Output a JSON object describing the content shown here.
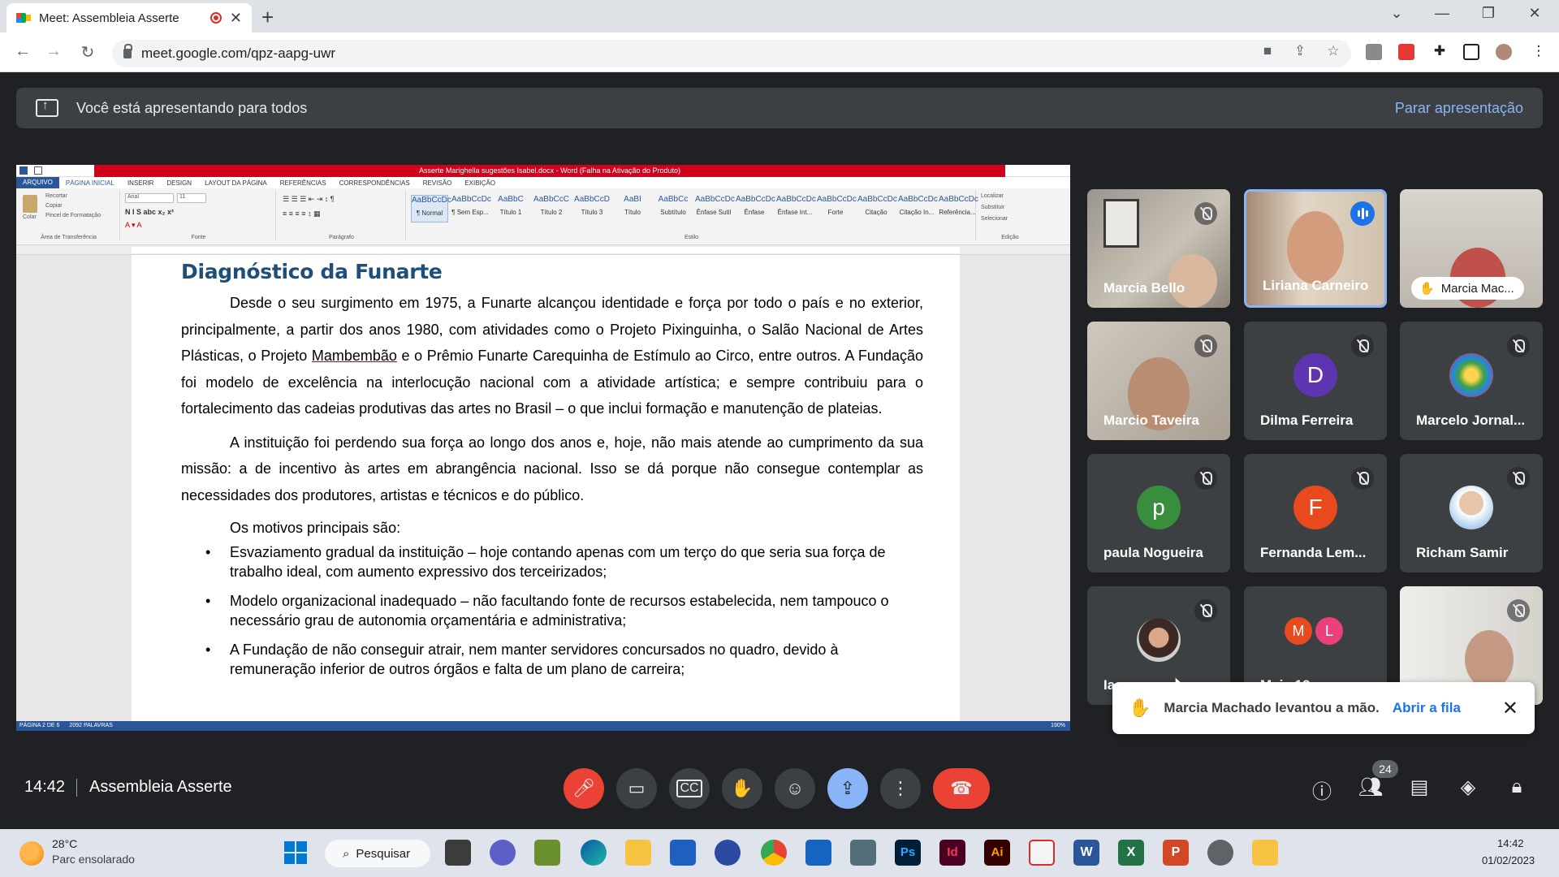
{
  "browser": {
    "tab_title": "Meet: Assembleia Asserte",
    "url": "meet.google.com/qpz-aapg-uwr",
    "new_tab": "+",
    "close_tab": "✕",
    "window_controls": [
      "⌄",
      "—",
      "❐",
      "✕"
    ]
  },
  "meet": {
    "presenting_text": "Você está apresentando para todos",
    "stop_presenting": "Parar apresentação",
    "time": "14:42",
    "meeting_name": "Assembleia Asserte",
    "participants_count": "24",
    "toast": {
      "message": "Marcia Machado levantou a mão.",
      "action": "Abrir a fila"
    },
    "tiles": [
      {
        "name": "Marcia Bello",
        "muted": true
      },
      {
        "name": "Liriana Carneiro",
        "muted": false,
        "speaking": true
      },
      {
        "name": "Marcia Mac...",
        "hand_raised": true
      },
      {
        "name": "Marcio Taveira",
        "muted": true
      },
      {
        "name": "Dilma Ferreira",
        "muted": true,
        "initial": "D",
        "color": "#5e35b1"
      },
      {
        "name": "Marcelo Jornal...",
        "muted": true
      },
      {
        "name": "paula Nogueira",
        "muted": true,
        "initial": "p",
        "color": "#388e3c"
      },
      {
        "name": "Fernanda Lem...",
        "muted": true,
        "initial": "F",
        "color": "#e8491d"
      },
      {
        "name": "Richam Samir",
        "muted": true
      },
      {
        "name": "Ia",
        "muted": true
      },
      {
        "name": "Mais 12 pessoas",
        "initials": [
          "M",
          "L"
        ]
      },
      {
        "name": "",
        "muted": true
      }
    ]
  },
  "word": {
    "title_bar": "Asserte Marighella sugestões Isabel.docx - Word (Falha na Ativação do Produto)",
    "tabs": [
      "ARQUIVO",
      "PÁGINA INICIAL",
      "INSERIR",
      "DESIGN",
      "LAYOUT DA PÁGINA",
      "REFERÊNCIAS",
      "CORRESPONDÊNCIAS",
      "REVISÃO",
      "EXIBIÇÃO"
    ],
    "clipboard": [
      "Recortar",
      "Copiar",
      "Pincel de Formatação"
    ],
    "paste": "Colar",
    "group_labels": [
      "Área de Transferência",
      "Fonte",
      "Parágrafo",
      "Estilo",
      "Edição"
    ],
    "font_name": "Arial",
    "font_size": "11",
    "styles": [
      {
        "sample": "AaBbCcDc",
        "label": "¶ Normal"
      },
      {
        "sample": "AaBbCcDc",
        "label": "¶ Sem Esp..."
      },
      {
        "sample": "AaBbC",
        "label": "Título 1"
      },
      {
        "sample": "AaBbCcC",
        "label": "Título 2"
      },
      {
        "sample": "AaBbCcD",
        "label": "Título 3"
      },
      {
        "sample": "AaBI",
        "label": "Título"
      },
      {
        "sample": "AaBbCc",
        "label": "Subtítulo"
      },
      {
        "sample": "AaBbCcDc",
        "label": "Ênfase Sutil"
      },
      {
        "sample": "AaBbCcDc",
        "label": "Ênfase"
      },
      {
        "sample": "AaBbCcDc",
        "label": "Ênfase Int..."
      },
      {
        "sample": "AaBbCcDc",
        "label": "Forte"
      },
      {
        "sample": "AaBbCcDc",
        "label": "Citação"
      },
      {
        "sample": "AaBbCcDc",
        "label": "Citação In..."
      },
      {
        "sample": "AaBbCcDc",
        "label": "Referência..."
      }
    ],
    "editing": [
      "Localizar",
      "Substituir",
      "Selecionar"
    ],
    "status": [
      "PÁGINA 2 DE 6",
      "2092 PALAVRAS"
    ],
    "zoom": "190%",
    "doc": {
      "heading": "Diagnóstico da Funarte",
      "p1_a": "Desde o seu surgimento em 1975, a Funarte alcançou identidade e força por todo o país e no exterior, principalmente, a partir dos anos 1980, com atividades como o Projeto Pixinguinha, o Salão Nacional de Artes Plásticas, o Projeto ",
      "p1_under": "Mambembão",
      "p1_b": " e o Prêmio Funarte Carequinha de Estímulo ao Circo, entre outros. A Fundação foi modelo de excelência na interlocução nacional com a atividade artística; e sempre contribuiu para o fortalecimento das cadeias produtivas das artes no Brasil – o que inclui formação e manutenção de plateias.",
      "p2": "A instituição foi perdendo sua força ao longo dos anos e, hoje, não mais atende ao cumprimento da sua missão: a de incentivo às artes em abrangência nacional. Isso se dá porque não consegue contemplar as necessidades dos produtores, artistas e técnicos e do público.",
      "motivos": "Os motivos principais são:",
      "bullets": [
        "Esvaziamento gradual da instituição – hoje contando apenas com um terço do que seria sua força de trabalho ideal, com aumento expressivo dos terceirizados;",
        "Modelo organizacional inadequado – não facultando fonte de recursos estabelecida, nem tampouco o necessário grau de autonomia orçamentária e administrativa;",
        "A Fundação de não conseguir atrair, nem manter servidores concursados no quadro, devido à remuneração inferior de outros órgãos e falta de um plano de carreira;"
      ]
    }
  },
  "taskbar": {
    "temp": "28°C",
    "weather": "Parc ensolarado",
    "search": "Pesquisar",
    "time": "14:42",
    "date": "01/02/2023"
  }
}
